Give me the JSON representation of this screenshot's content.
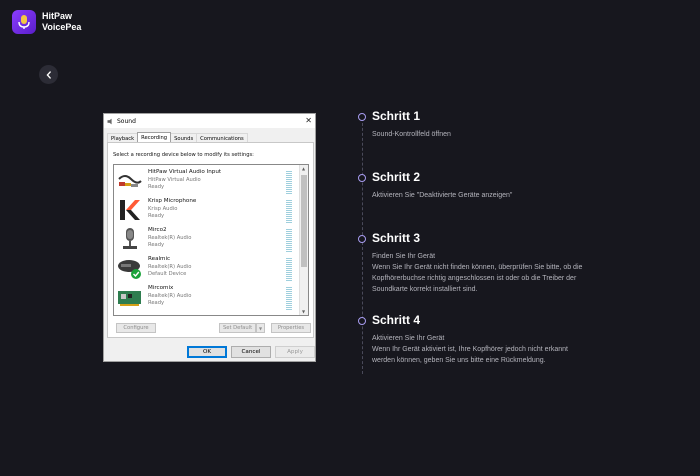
{
  "brand": {
    "line1": "HitPaw",
    "line2": "VoicePea"
  },
  "dialog": {
    "title": "Sound",
    "tabs": [
      "Playback",
      "Recording",
      "Sounds",
      "Communications"
    ],
    "active_tab": "Recording",
    "instruction": "Select a recording device below to modify its settings:",
    "devices": [
      {
        "name": "HitPaw Virtual Audio Input",
        "sub1": "HitPaw Virtual Audio",
        "sub2": "Ready",
        "icon": "audio-cable-icon"
      },
      {
        "name": "Krisp Microphone",
        "sub1": "Krisp Audio",
        "sub2": "Ready",
        "icon": "krisp-logo-icon"
      },
      {
        "name": "Mirco2",
        "sub1": "Realtek(R) Audio",
        "sub2": "Ready",
        "icon": "microphone-icon"
      },
      {
        "name": "Realmic",
        "sub1": "Realtek(R) Audio",
        "sub2": "Default Device",
        "icon": "headset-mic-default-icon"
      },
      {
        "name": "Mircomix",
        "sub1": "Realtek(R) Audio",
        "sub2": "Ready",
        "icon": "sound-card-icon"
      }
    ],
    "configure": "Configure",
    "set_default": "Set Default",
    "properties": "Properties",
    "ok": "OK",
    "cancel": "Cancel",
    "apply": "Apply"
  },
  "steps": [
    {
      "title": "Schritt 1",
      "desc": "Sound-Kontrollfeld öffnen"
    },
    {
      "title": "Schritt 2",
      "desc": "Aktivieren Sie \"Deaktivierte Geräte anzeigen\""
    },
    {
      "title": "Schritt 3",
      "desc": "Finden Sie Ihr Gerät\nWenn Sie Ihr Gerät nicht finden können, überprüfen Sie bitte, ob die Kopfhörerbuchse richtig angeschlossen ist oder ob die Treiber der Soundkarte korrekt installiert sind."
    },
    {
      "title": "Schritt 4",
      "desc": "Aktivieren Sie Ihr Gerät\nWenn Ihr Gerät aktiviert ist, Ihre Kopfhörer jedoch nicht erkannt werden können, geben Sie uns bitte eine Rückmeldung."
    }
  ],
  "colors": {
    "background": "#17171e",
    "accent": "#a89cf0",
    "brand": "#8b3dff"
  }
}
